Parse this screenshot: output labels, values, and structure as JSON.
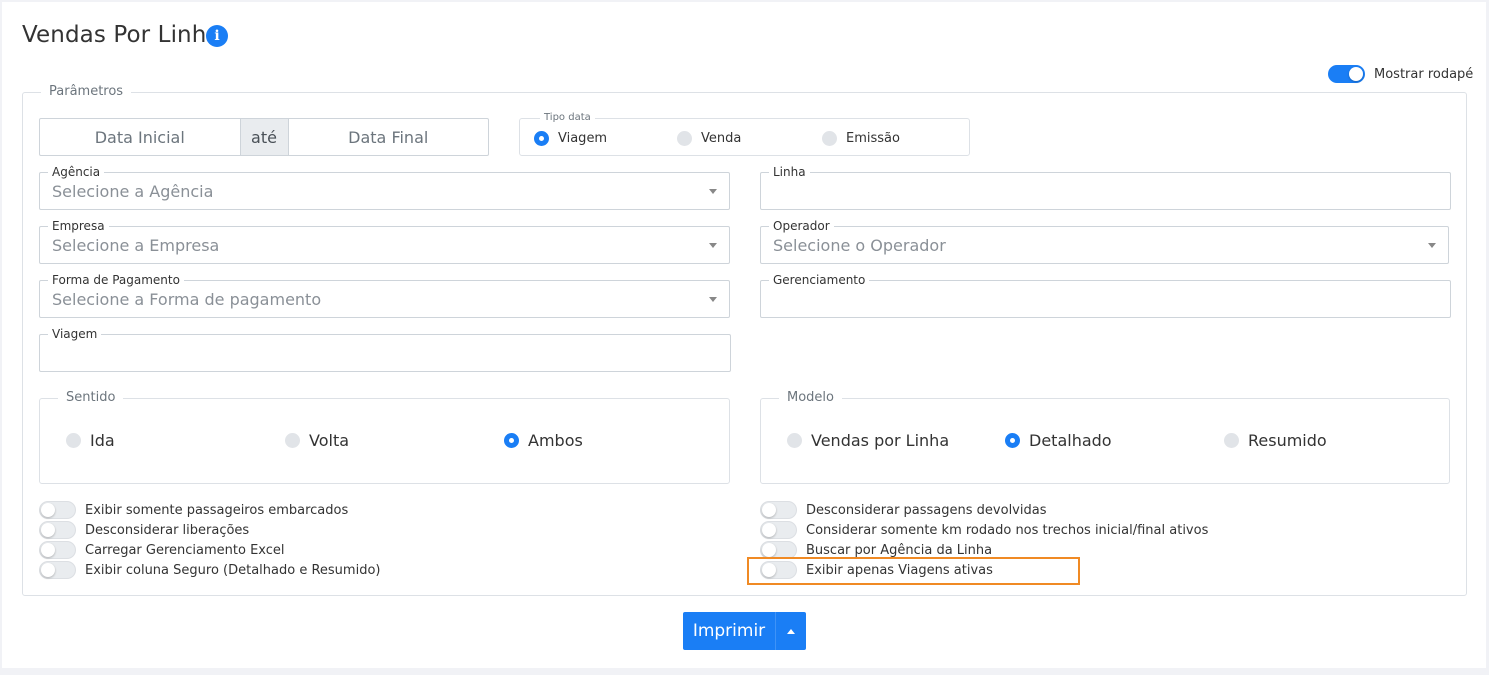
{
  "page": {
    "title": "Vendas Por Linha"
  },
  "icons": {
    "info": "info-icon",
    "caret": "chevron-down-icon",
    "split": "caret-up-icon"
  },
  "footer_toggle": {
    "label": "Mostrar rodapé",
    "on": true
  },
  "params": {
    "legend": "Parâmetros",
    "date": {
      "start_placeholder": "Data Inicial",
      "separator": "até",
      "end_placeholder": "Data Final"
    },
    "tipo_data": {
      "legend": "Tipo data",
      "options": [
        "Viagem",
        "Venda",
        "Emissão"
      ],
      "selected": "Viagem"
    },
    "fields": {
      "agencia": {
        "label": "Agência",
        "value": "Selecione a Agência"
      },
      "linha": {
        "label": "Linha",
        "value": ""
      },
      "empresa": {
        "label": "Empresa",
        "value": "Selecione a Empresa"
      },
      "operador": {
        "label": "Operador",
        "value": "Selecione o Operador"
      },
      "forma_pagamento": {
        "label": "Forma de Pagamento",
        "value": "Selecione a Forma de pagamento"
      },
      "gerenciamento": {
        "label": "Gerenciamento",
        "value": ""
      },
      "viagem": {
        "label": "Viagem",
        "value": ""
      }
    },
    "sentido": {
      "legend": "Sentido",
      "options": [
        "Ida",
        "Volta",
        "Ambos"
      ],
      "selected": "Ambos"
    },
    "modelo": {
      "legend": "Modelo",
      "options": [
        "Vendas por Linha",
        "Detalhado",
        "Resumido"
      ],
      "selected": "Detalhado"
    },
    "toggles_left": [
      "Exibir somente passageiros embarcados",
      "Desconsiderar liberações",
      "Carregar Gerenciamento Excel",
      "Exibir coluna Seguro (Detalhado e Resumido)"
    ],
    "toggles_right": [
      "Desconsiderar passagens devolvidas",
      "Considerar somente km rodado nos trechos inicial/final ativos",
      "Buscar por Agência da Linha",
      "Exibir apenas Viagens ativas"
    ]
  },
  "actions": {
    "print_label": "Imprimir"
  },
  "colors": {
    "accent": "#1a7ef5",
    "highlight": "#f08a24"
  }
}
